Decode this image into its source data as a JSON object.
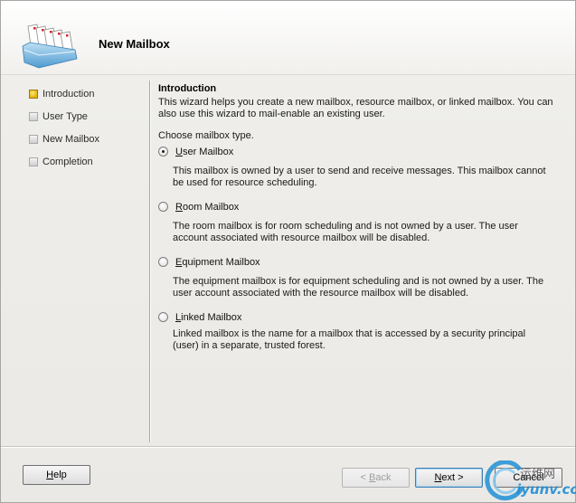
{
  "header": {
    "title": "New Mailbox"
  },
  "nav": {
    "items": [
      {
        "label": "Introduction",
        "active": true
      },
      {
        "label": "User Type",
        "active": false
      },
      {
        "label": "New Mailbox",
        "active": false
      },
      {
        "label": "Completion",
        "active": false
      }
    ]
  },
  "content": {
    "section_title": "Introduction",
    "intro": "This wizard helps you create a new mailbox, resource mailbox, or linked mailbox. You can also use this wizard to mail-enable an existing user.",
    "choose_label": "Choose mailbox type.",
    "options": [
      {
        "accel": "U",
        "rest": "ser Mailbox",
        "checked": true,
        "description": "This mailbox is owned by a user to send and receive messages. This mailbox cannot be used for resource scheduling."
      },
      {
        "pre": "",
        "accel": "R",
        "rest": "oom Mailbox",
        "checked": false,
        "description": "The room mailbox is for room scheduling and is not owned by a user. The user account associated with resource mailbox will be disabled."
      },
      {
        "accel": "E",
        "rest": "quipment Mailbox",
        "checked": false,
        "description": "The equipment mailbox is for equipment scheduling and is not owned by a user. The user account associated with the resource mailbox will be disabled."
      },
      {
        "accel": "L",
        "rest": "inked Mailbox",
        "checked": false,
        "description": "Linked mailbox is the name for a mailbox that is accessed by a security principal (user) in a separate, trusted forest."
      }
    ]
  },
  "buttons": {
    "help": {
      "accel": "H",
      "rest": "elp"
    },
    "back": {
      "pre": "< ",
      "accel": "B",
      "rest": "ack"
    },
    "next": {
      "accel": "N",
      "rest": "ext >"
    },
    "cancel": "Cancel"
  },
  "watermark": {
    "chinese": "运维网",
    "url": "iyunv.com"
  }
}
